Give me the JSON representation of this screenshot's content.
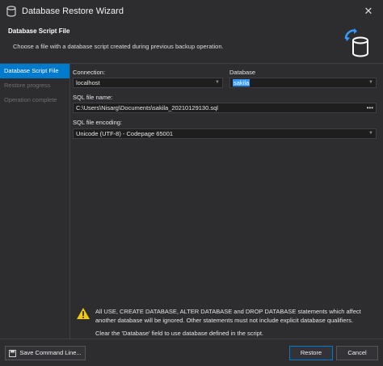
{
  "window": {
    "title": "Database Restore Wizard",
    "icon": "database-restore-icon",
    "close_glyph": "✕"
  },
  "header": {
    "title": "Database Script File",
    "subtitle": "Choose a file with a database script created during previous backup operation.",
    "icon": "database-restore-icon"
  },
  "sidebar": {
    "items": [
      {
        "label": "Database Script File",
        "active": true
      },
      {
        "label": "Restore progress",
        "active": false
      },
      {
        "label": "Operation complete",
        "active": false
      }
    ]
  },
  "form": {
    "connection_label": "Connection:",
    "connection_value": "localhost",
    "database_label": "Database",
    "database_value": "sakila",
    "sql_file_label": "SQL file name:",
    "sql_file_value": "C:\\Users\\Nisarg\\Documents\\sakila_20210129130.sql",
    "browse_glyph": "•••",
    "encoding_label": "SQL file encoding:",
    "encoding_value": "Unicode (UTF-8) - Codepage 65001"
  },
  "warning": {
    "text": "All USE, CREATE DATABASE, ALTER DATABASE and DROP DATABASE statements which affect another database will be ignored. Other statements must not include explicit database qualifiers.",
    "hint": "Clear the 'Database' field to use database defined in the script.",
    "icon": "warning-icon"
  },
  "footer": {
    "save_label": "Save Command Line...",
    "restore_label": "Restore",
    "cancel_label": "Cancel"
  },
  "colors": {
    "background": "#2d2d30",
    "accent": "#007acc",
    "field": "#1e1e1e",
    "border": "#3f3f46",
    "warning": "#f2c811"
  }
}
